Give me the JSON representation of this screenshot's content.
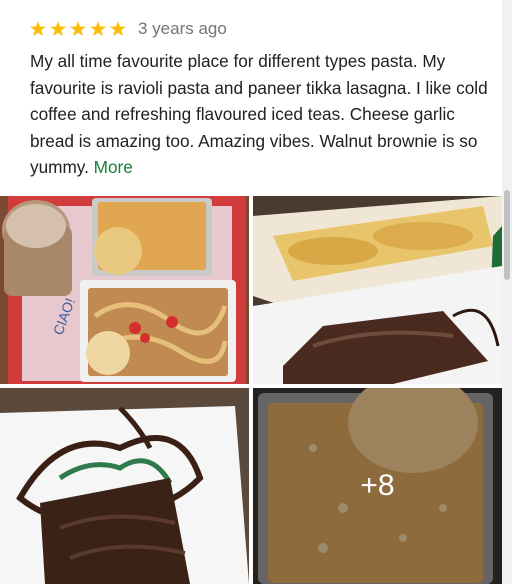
{
  "review": {
    "rating": 5,
    "stars": [
      "★",
      "★",
      "★",
      "★",
      "★"
    ],
    "date": "3 years ago",
    "text": "My all time favourite place for different types pasta. My favourite is ravioli pasta and paneer tikka lasagna. I like cold coffee and refreshing flavoured iced teas. Cheese garlic bread is amazing too. Amazing vibes. Walnut brownie is so yummy.",
    "more_label": "More",
    "photos": [
      {
        "icon": "food-photo-pasta-tray"
      },
      {
        "icon": "food-photo-garlic-bread-brownie"
      },
      {
        "icon": "food-photo-brownie-chocolate"
      },
      {
        "icon": "food-photo-lasagna"
      }
    ],
    "more_photos_label": "+8"
  },
  "colors": {
    "star": "#fbbc04",
    "date": "#70757a",
    "text": "#202124",
    "link": "#188038"
  }
}
